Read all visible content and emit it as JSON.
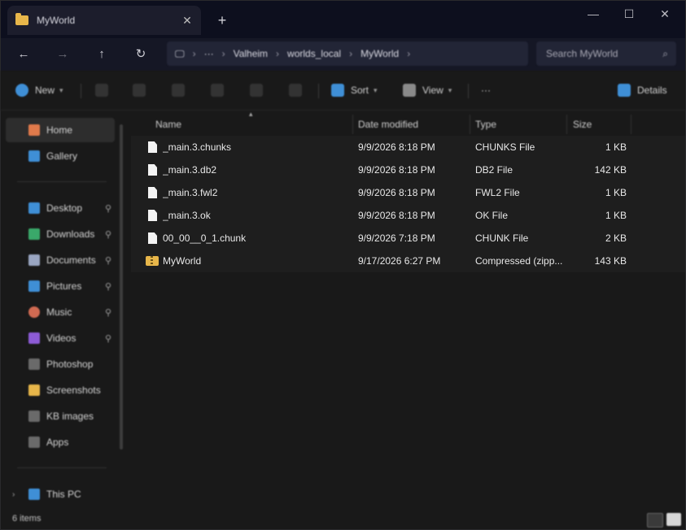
{
  "window": {
    "tab_title": "MyWorld",
    "tab_close": "✕",
    "new_tab": "+",
    "minimize": "—",
    "maximize": "☐",
    "close": "✕"
  },
  "nav": {
    "back": "←",
    "forward": "→",
    "up": "↑",
    "refresh": "↻",
    "breadcrumb": [
      "Valheim",
      "worlds_local",
      "MyWorld"
    ],
    "overflow": "···",
    "search_placeholder": "Search MyWorld"
  },
  "commandbar": {
    "new_label": "New",
    "sort_label": "Sort",
    "view_label": "View",
    "more_label": "···",
    "details_label": "Details"
  },
  "sidebar": {
    "items": [
      {
        "label": "Home",
        "icon": "home-icon",
        "color": "#e07a4b",
        "pinned": false,
        "active": true
      },
      {
        "label": "Gallery",
        "icon": "gallery-icon",
        "color": "#3f8fd6",
        "pinned": false
      },
      {
        "label": "Desktop",
        "icon": "desktop-icon",
        "color": "#3f8fd6",
        "pinned": true
      },
      {
        "label": "Downloads",
        "icon": "downloads-icon",
        "color": "#3aa86a",
        "pinned": true
      },
      {
        "label": "Documents",
        "icon": "documents-icon",
        "color": "#9aa6c2",
        "pinned": true
      },
      {
        "label": "Pictures",
        "icon": "pictures-icon",
        "color": "#3f8fd6",
        "pinned": true
      },
      {
        "label": "Music",
        "icon": "music-icon",
        "color": "#d06a52",
        "pinned": true
      },
      {
        "label": "Videos",
        "icon": "videos-icon",
        "color": "#8d5bd6",
        "pinned": true
      },
      {
        "label": "Photoshop",
        "icon": "folder-icon",
        "color": "#6a6a6a",
        "pinned": false
      },
      {
        "label": "Screenshots",
        "icon": "folder-icon",
        "color": "#e7b64a",
        "pinned": false
      },
      {
        "label": "KB images",
        "icon": "folder-icon",
        "color": "#6a6a6a",
        "pinned": false
      },
      {
        "label": "Apps",
        "icon": "folder-icon",
        "color": "#6a6a6a",
        "pinned": false
      },
      {
        "label": "This PC",
        "icon": "this-pc-icon",
        "color": "#3f8fd6",
        "pinned": false
      }
    ],
    "pin_glyph": "📌"
  },
  "table": {
    "columns": {
      "name": "Name",
      "date": "Date modified",
      "type": "Type",
      "size": "Size"
    },
    "rows": [
      {
        "name": "_main.3.chunks",
        "date": "9/9/2026 8:18 PM",
        "type": "CHUNKS File",
        "size": "1 KB",
        "icon": "file-icon"
      },
      {
        "name": "_main.3.db2",
        "date": "9/9/2026 8:18 PM",
        "type": "DB2 File",
        "size": "142 KB",
        "icon": "file-icon"
      },
      {
        "name": "_main.3.fwl2",
        "date": "9/9/2026 8:18 PM",
        "type": "FWL2 File",
        "size": "1 KB",
        "icon": "file-icon"
      },
      {
        "name": "_main.3.ok",
        "date": "9/9/2026 8:18 PM",
        "type": "OK File",
        "size": "1 KB",
        "icon": "file-icon"
      },
      {
        "name": "00_00__0_1.chunk",
        "date": "9/9/2026 7:18 PM",
        "type": "CHUNK File",
        "size": "2 KB",
        "icon": "file-icon"
      },
      {
        "name": "MyWorld",
        "date": "9/17/2026 6:27 PM",
        "type": "Compressed (zipp...",
        "size": "143 KB",
        "icon": "zip-folder-icon"
      }
    ]
  },
  "status": {
    "item_count": "6 items"
  }
}
